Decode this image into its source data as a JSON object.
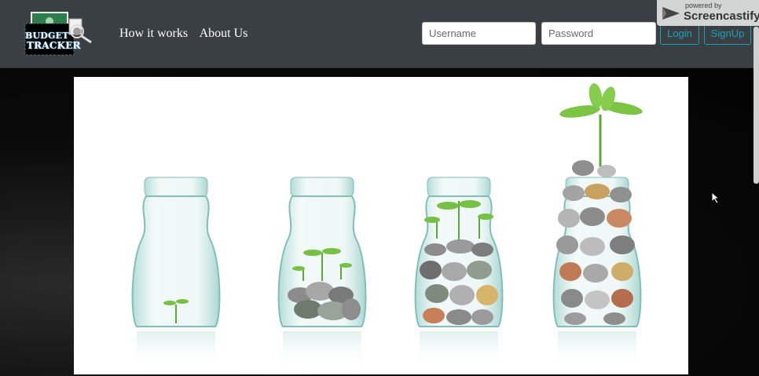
{
  "brand": {
    "logo_line1": "BUDGET",
    "logo_line2": "TRACKER"
  },
  "nav": {
    "links": [
      "How it works",
      "About Us"
    ]
  },
  "login_form": {
    "username_placeholder": "Username",
    "password_placeholder": "Password",
    "login_label": "Login",
    "signup_label": "SignUp"
  },
  "watermark": {
    "small": "powered by",
    "big": "Screencastify"
  },
  "hero": {
    "icon": "coin-jars-with-sprouts-image"
  },
  "colors": {
    "navbar": "#3a3f44",
    "accent": "#17a2b8",
    "page_background": "#050505"
  }
}
